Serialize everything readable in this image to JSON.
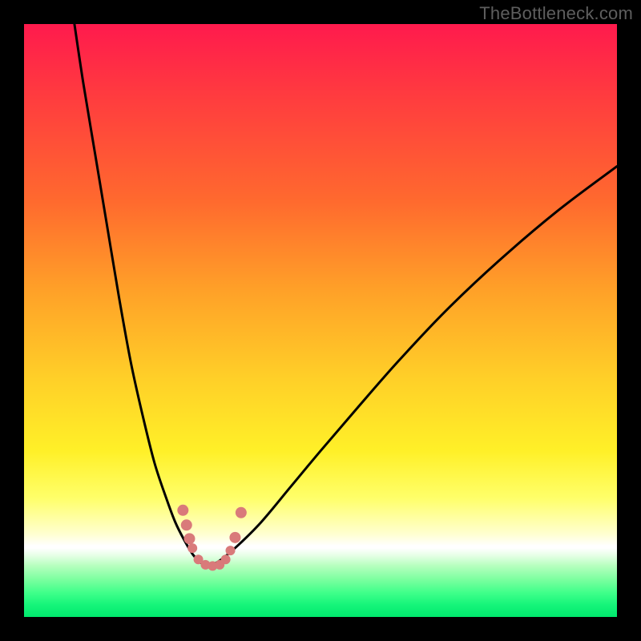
{
  "watermark": "TheBottleneck.com",
  "colors": {
    "frame": "#000000",
    "gradient_top": "#ff1a4d",
    "gradient_mid": "#ffd028",
    "gradient_low": "#ffffd0",
    "green_band_top": "#ffffff",
    "green_band_bottom": "#00e86d",
    "curve": "#000000",
    "marker": "#d97a7a"
  },
  "chart_data": {
    "type": "line",
    "title": "",
    "xlabel": "",
    "ylabel": "",
    "xlim": [
      0,
      100
    ],
    "ylim": [
      0,
      100
    ],
    "note": "x and y are percentages of plot area; y=0 is top, y=100 is bottom (screen coords). Two curve branches form a V with minimum near x≈31.",
    "series": [
      {
        "name": "left-branch",
        "x": [
          8.5,
          10,
          12,
          14,
          16,
          18,
          20,
          22,
          24,
          25.5,
          27,
          28.5,
          30,
          31
        ],
        "y": [
          0,
          10,
          22,
          34,
          46,
          57,
          66,
          74,
          80,
          84,
          87,
          89.5,
          91,
          91.5
        ]
      },
      {
        "name": "right-branch",
        "x": [
          31,
          33,
          36,
          40,
          45,
          50,
          56,
          63,
          71,
          80,
          90,
          100
        ],
        "y": [
          91.5,
          90.5,
          88,
          84,
          78,
          72,
          65,
          57,
          48.5,
          40,
          31.5,
          24
        ]
      }
    ],
    "markers": {
      "name": "pink-dots-near-minimum",
      "color": "#d97a7a",
      "points": [
        {
          "x": 26.8,
          "y": 82.0,
          "r": 7
        },
        {
          "x": 27.4,
          "y": 84.5,
          "r": 7
        },
        {
          "x": 27.9,
          "y": 86.8,
          "r": 7
        },
        {
          "x": 28.4,
          "y": 88.4,
          "r": 6
        },
        {
          "x": 29.4,
          "y": 90.3,
          "r": 6
        },
        {
          "x": 30.6,
          "y": 91.2,
          "r": 6
        },
        {
          "x": 31.8,
          "y": 91.4,
          "r": 6
        },
        {
          "x": 33.0,
          "y": 91.2,
          "r": 6
        },
        {
          "x": 34.0,
          "y": 90.3,
          "r": 6
        },
        {
          "x": 34.8,
          "y": 88.8,
          "r": 6
        },
        {
          "x": 35.6,
          "y": 86.6,
          "r": 7
        },
        {
          "x": 36.6,
          "y": 82.4,
          "r": 7
        }
      ]
    },
    "green_band_y_range_pct": [
      88.4,
      100
    ]
  }
}
